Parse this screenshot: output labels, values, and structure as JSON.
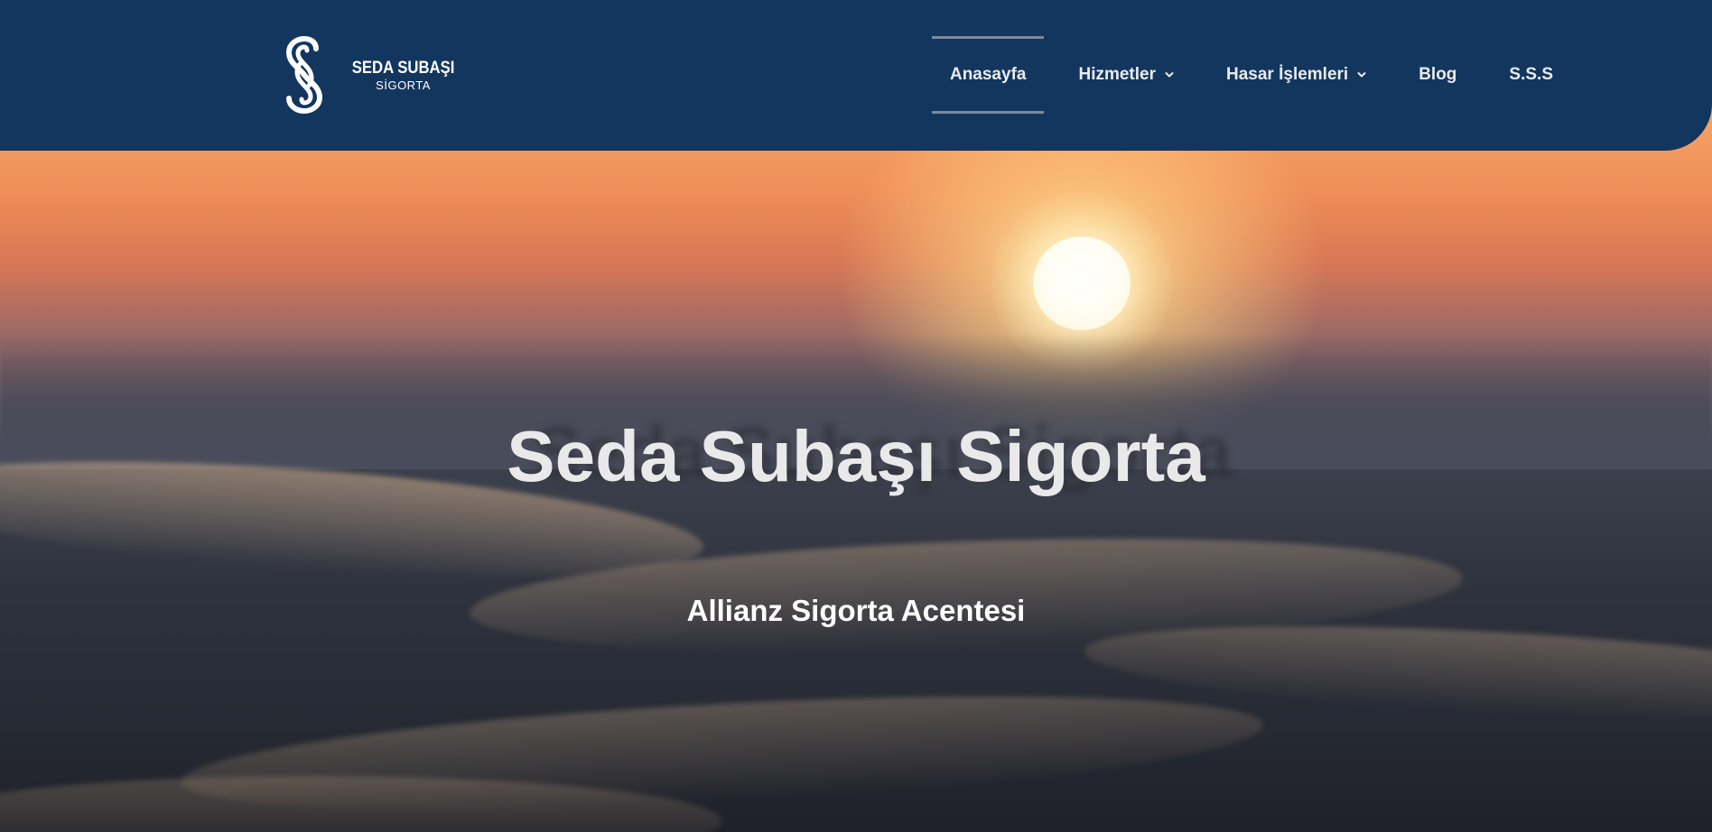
{
  "brand": {
    "name": "SEDA SUBAŞI",
    "sub": "SİGORTA",
    "colors": {
      "header_bg": "#13365e",
      "nav_text": "#e8ebef",
      "active_border": "#7d8a99"
    }
  },
  "nav": {
    "items": [
      {
        "label": "Anasayfa",
        "active": true,
        "has_dropdown": false
      },
      {
        "label": "Hizmetler",
        "active": false,
        "has_dropdown": true
      },
      {
        "label": "Hasar İşlemleri",
        "active": false,
        "has_dropdown": true
      },
      {
        "label": "Blog",
        "active": false,
        "has_dropdown": false
      },
      {
        "label": "S.S.S",
        "active": false,
        "has_dropdown": false
      }
    ],
    "dropdown_icon": "chevron-down-icon"
  },
  "hero": {
    "title": "Seda Subaşı Sigorta",
    "subtitle": "Allianz Sigorta Acentesi",
    "background": "sunset-over-sea-image"
  }
}
